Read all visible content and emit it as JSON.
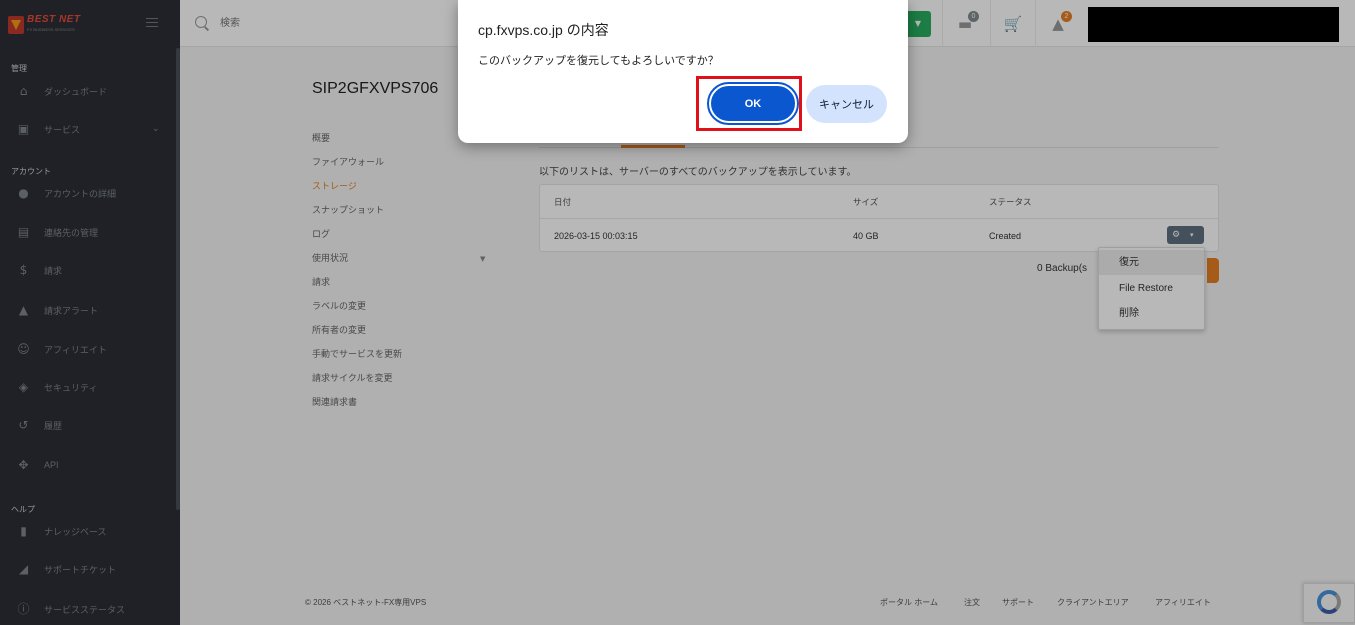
{
  "header": {
    "search_placeholder": "検索",
    "cart_badge": "",
    "tickets_badge": "0",
    "notif_badge": "2"
  },
  "sidebar": {
    "logo_text": "BEST NET",
    "logo_sub": "FX BUSINESS SERVICES",
    "sections": {
      "manage": "管理",
      "account": "アカウント",
      "help": "ヘルプ"
    },
    "items": [
      {
        "label": "ダッシュボード"
      },
      {
        "label": "サービス"
      },
      {
        "label": "アカウントの詳細"
      },
      {
        "label": "連絡先の管理"
      },
      {
        "label": "請求"
      },
      {
        "label": "請求アラート"
      },
      {
        "label": "アフィリエイト"
      },
      {
        "label": "セキュリティ"
      },
      {
        "label": "履歴"
      },
      {
        "label": "API"
      },
      {
        "label": "ナレッジベース"
      },
      {
        "label": "サポートチケット"
      },
      {
        "label": "サービスステータス"
      }
    ]
  },
  "main": {
    "title": "SIP2GFXVPS706",
    "nav": [
      "概要",
      "ファイアウォール",
      "ストレージ",
      "スナップショット",
      "ログ",
      "使用状況",
      "請求",
      "ラベルの変更",
      "所有者の変更",
      "手動でサービスを更新",
      "請求サイクルを変更",
      "関連請求書"
    ],
    "list_desc": "以下のリストは、サーバーのすべてのバックアップを表示しています。",
    "table": {
      "headers": [
        "日付",
        "サイズ",
        "ステータス"
      ],
      "rows": [
        {
          "date": "2026-03-15 00:03:15",
          "size": "40 GB",
          "status": "Created"
        }
      ]
    },
    "backups_count": "0 Backup(s",
    "dropdown": [
      "復元",
      "File Restore",
      "削除"
    ]
  },
  "footer": {
    "copy": "© 2026 ベストネット-FX専用VPS",
    "links": [
      "ポータル ホーム",
      "注文",
      "サポート",
      "クライアントエリア",
      "アフィリエイト"
    ]
  },
  "dialog": {
    "title": "cp.fxvps.co.jp の内容",
    "message": "このバックアップを復元してもよろしいですか？",
    "ok": "OK",
    "cancel": "キャンセル"
  }
}
